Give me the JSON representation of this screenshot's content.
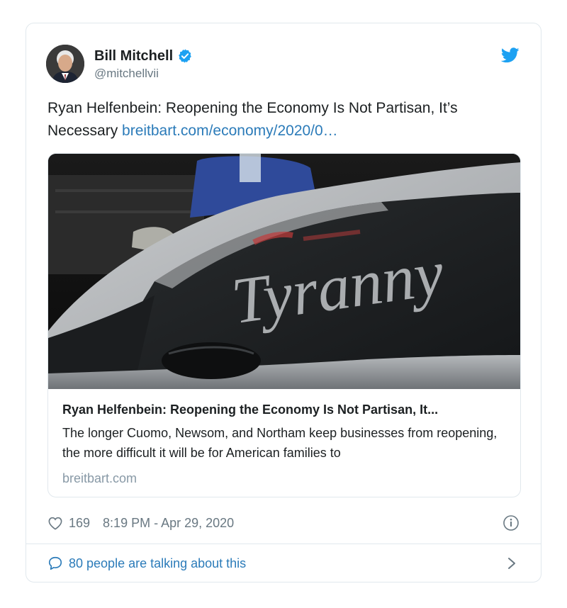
{
  "author": {
    "name": "Bill Mitchell",
    "handle": "@mitchellvii",
    "verified": true
  },
  "tweet": {
    "text": "Ryan Helfenbein: Reopening the Economy Is Not Partisan, It’s Necessary ",
    "link_text": "breitbart.com/economy/2020/0…"
  },
  "card": {
    "title": "Ryan Helfenbein: Reopening the Economy Is Not Partisan, It...",
    "description": "The longer Cuomo, Newsom, and Northam keep businesses from reopening, the more difficult it will be for American families to",
    "domain": "breitbart.com",
    "image_text": "Tyranny"
  },
  "meta": {
    "like_count": "169",
    "timestamp": "8:19 PM - Apr 29, 2020"
  },
  "conversation": {
    "label": "80 people are talking about this"
  },
  "icons": {
    "brand": "twitter-bird-icon",
    "verified": "verified-badge-icon",
    "like": "heart-icon",
    "info": "info-icon",
    "reply": "speech-bubble-icon",
    "more": "chevron-right-icon"
  },
  "colors": {
    "link": "#2b7bb9",
    "twitter_blue": "#1da1f2",
    "muted": "#697882",
    "border": "#e1e8ed"
  }
}
